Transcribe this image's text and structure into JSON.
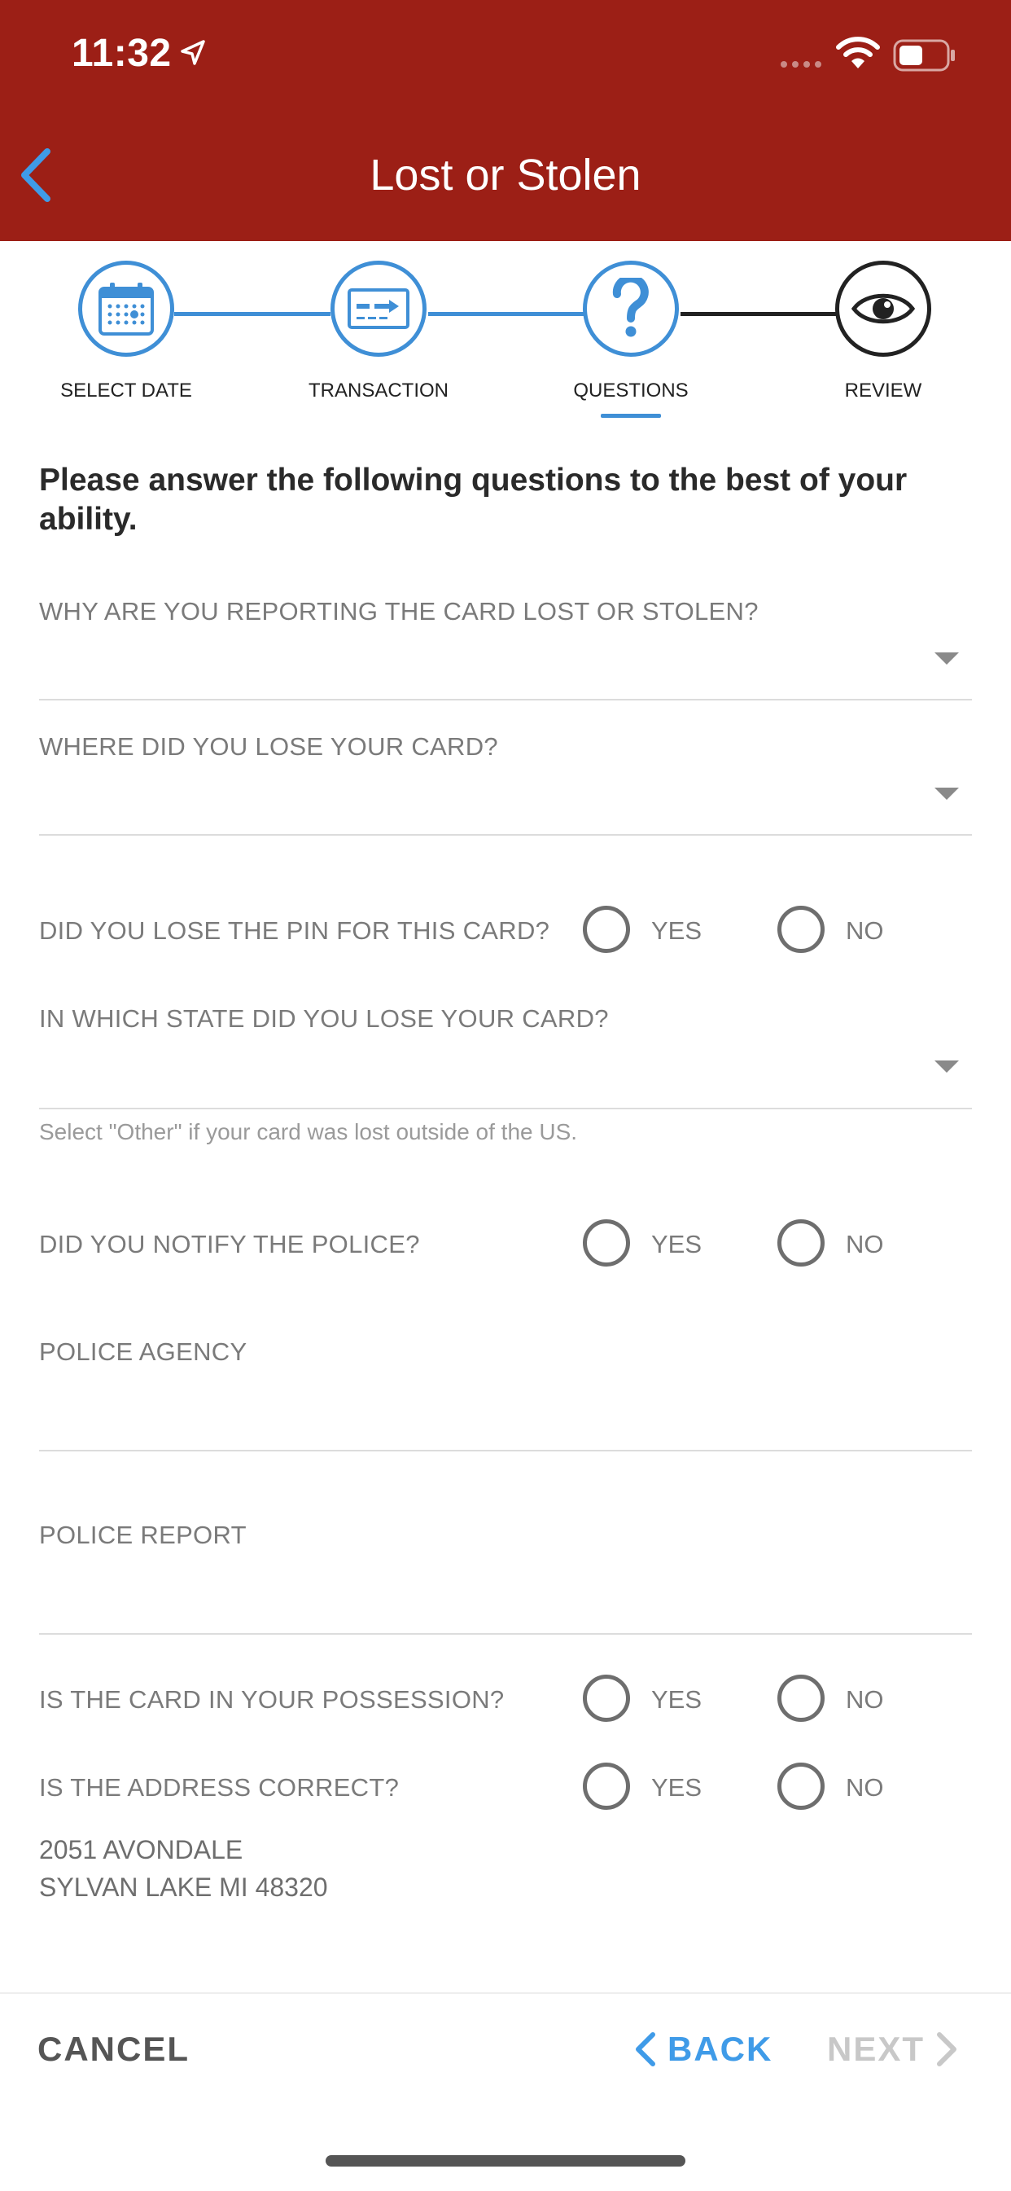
{
  "status_bar": {
    "time": "11:32"
  },
  "header": {
    "title": "Lost or Stolen"
  },
  "stepper": {
    "steps": [
      {
        "label": "SELECT DATE",
        "icon": "calendar-icon",
        "state": "complete"
      },
      {
        "label": "TRANSACTION",
        "icon": "card-transaction-icon",
        "state": "complete"
      },
      {
        "label": "QUESTIONS",
        "icon": "question-icon",
        "state": "current"
      },
      {
        "label": "REVIEW",
        "icon": "eye-icon",
        "state": "upcoming"
      }
    ]
  },
  "form": {
    "intro": "Please answer the following questions to the best of your ability.",
    "reason_label": "WHY ARE YOU REPORTING THE CARD LOST OR STOLEN?",
    "where_label": "WHERE DID YOU LOSE YOUR CARD?",
    "pin_label": "DID YOU LOSE THE PIN FOR THIS CARD?",
    "state_label": "IN WHICH STATE DID YOU LOSE YOUR CARD?",
    "state_helper": "Select \"Other\" if your card was lost outside of the US.",
    "police_label": "DID YOU NOTIFY THE POLICE?",
    "agency_label": "POLICE AGENCY",
    "report_label": "POLICE REPORT",
    "possession_label": "IS THE CARD IN YOUR POSSESSION?",
    "address_label": "IS THE ADDRESS CORRECT?",
    "yes": "YES",
    "no": "NO",
    "address_line1": "2051 AVONDALE",
    "address_line2": "SYLVAN LAKE MI 48320"
  },
  "footer": {
    "cancel": "CANCEL",
    "back": "BACK",
    "next": "NEXT"
  },
  "colors": {
    "header_bg": "#9c1f16",
    "accent": "#3f8fd6",
    "back_blue": "#3f9be8",
    "disabled": "#c8c8c8"
  }
}
